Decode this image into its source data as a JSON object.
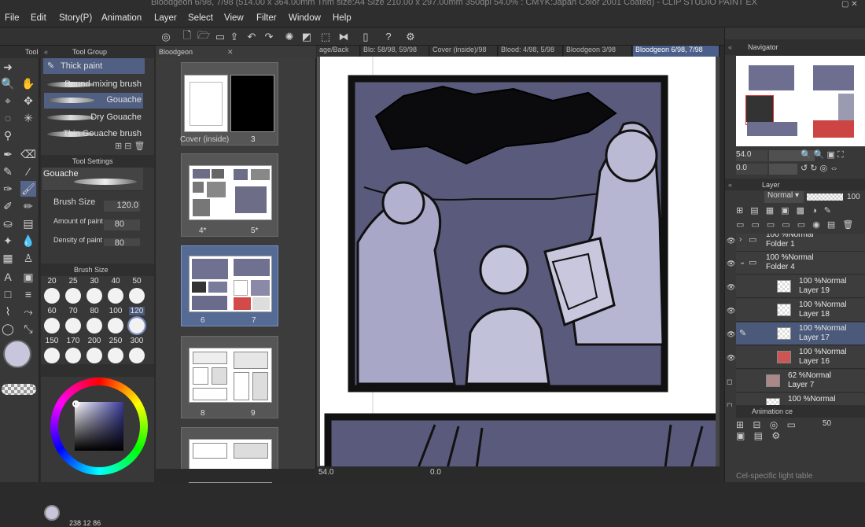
{
  "window": {
    "title": "Bloodgeon 6/98, 7/98 (514.00 x 364.00mm Trim size:A4 Size 210.00 x 297.00mm 350dpi 54.0% : CMYK:Japan Color 2001 Coated) - CLIP STUDIO PAINT EX"
  },
  "menu": [
    "File",
    "Edit",
    "Story(P)",
    "Animation",
    "Layer",
    "Select",
    "View",
    "Filter",
    "Window",
    "Help"
  ],
  "panels": {
    "tool": "Tool",
    "tool_group": "Tool Group",
    "tool_settings": "Tool Settings",
    "brush_size_panel": "Brush Size",
    "navigator": "Navigator",
    "layer": "Layer",
    "animation": "Animation ce",
    "cel_table": "Cel-specific light table"
  },
  "tool_group": {
    "active": "Thick paint"
  },
  "subtools": [
    "Round mixing brush",
    "Gouache",
    "Dry Gouache",
    "Thin Gouache brush"
  ],
  "tool_settings": {
    "name": "Gouache",
    "brush_size_label": "Brush Size",
    "brush_size_value": "120.0",
    "amount_label": "Amount of paint",
    "amount_value": "80",
    "density_label": "Density of paint",
    "density_value": "80"
  },
  "brush_sizes": [
    "20",
    "25",
    "30",
    "40",
    "50",
    "60",
    "70",
    "80",
    "100",
    "120",
    "150",
    "170",
    "200",
    "250",
    "300"
  ],
  "brush_size_selected": "120",
  "color": {
    "main": "#c8c6dc",
    "sub": "#b8bfd4",
    "accent": "#4b5a7a"
  },
  "color_wheel_values": {
    "left": "238",
    "mid": "12",
    "right": "86"
  },
  "pages": {
    "tab_label": "Bloodgeon",
    "items": [
      {
        "left": "Cover (inside)",
        "right": "3"
      },
      {
        "left": "4*",
        "right": "5*"
      },
      {
        "left": "6",
        "right": "7"
      },
      {
        "left": "8",
        "right": "9"
      }
    ]
  },
  "tabs": [
    "age/Back",
    "Blo: 58/98, 59/98",
    "Cover (inside)/98",
    "Blood: 4/98, 5/98",
    "Bloodgeon  3/98",
    "Bloodgeon 6/98, 7/98"
  ],
  "navigator": {
    "zoom": "54.0",
    "rotation": "0.0"
  },
  "layer_panel": {
    "blend": "Normal",
    "opacity": "100"
  },
  "layers": [
    {
      "mode": "100 %Normal",
      "name": "Folder 1",
      "type": "folder",
      "open": false
    },
    {
      "mode": "100 %Normal",
      "name": "Folder 4",
      "type": "folder",
      "open": true
    },
    {
      "mode": "100 %Normal",
      "name": "Layer 19",
      "type": "layer"
    },
    {
      "mode": "100 %Normal",
      "name": "Layer 18",
      "type": "layer"
    },
    {
      "mode": "100 %Normal",
      "name": "Layer 17",
      "type": "layer",
      "selected": true
    },
    {
      "mode": "100 %Normal",
      "name": "Layer 16",
      "type": "layer"
    },
    {
      "mode": "62 %Normal",
      "name": "Layer 7",
      "type": "layer"
    },
    {
      "mode": "100 %Normal",
      "name": "",
      "type": "layer"
    }
  ],
  "animation": {
    "opacity": "50"
  },
  "statusbar": {
    "zoom": "54.0",
    "rotation": "0.0"
  }
}
